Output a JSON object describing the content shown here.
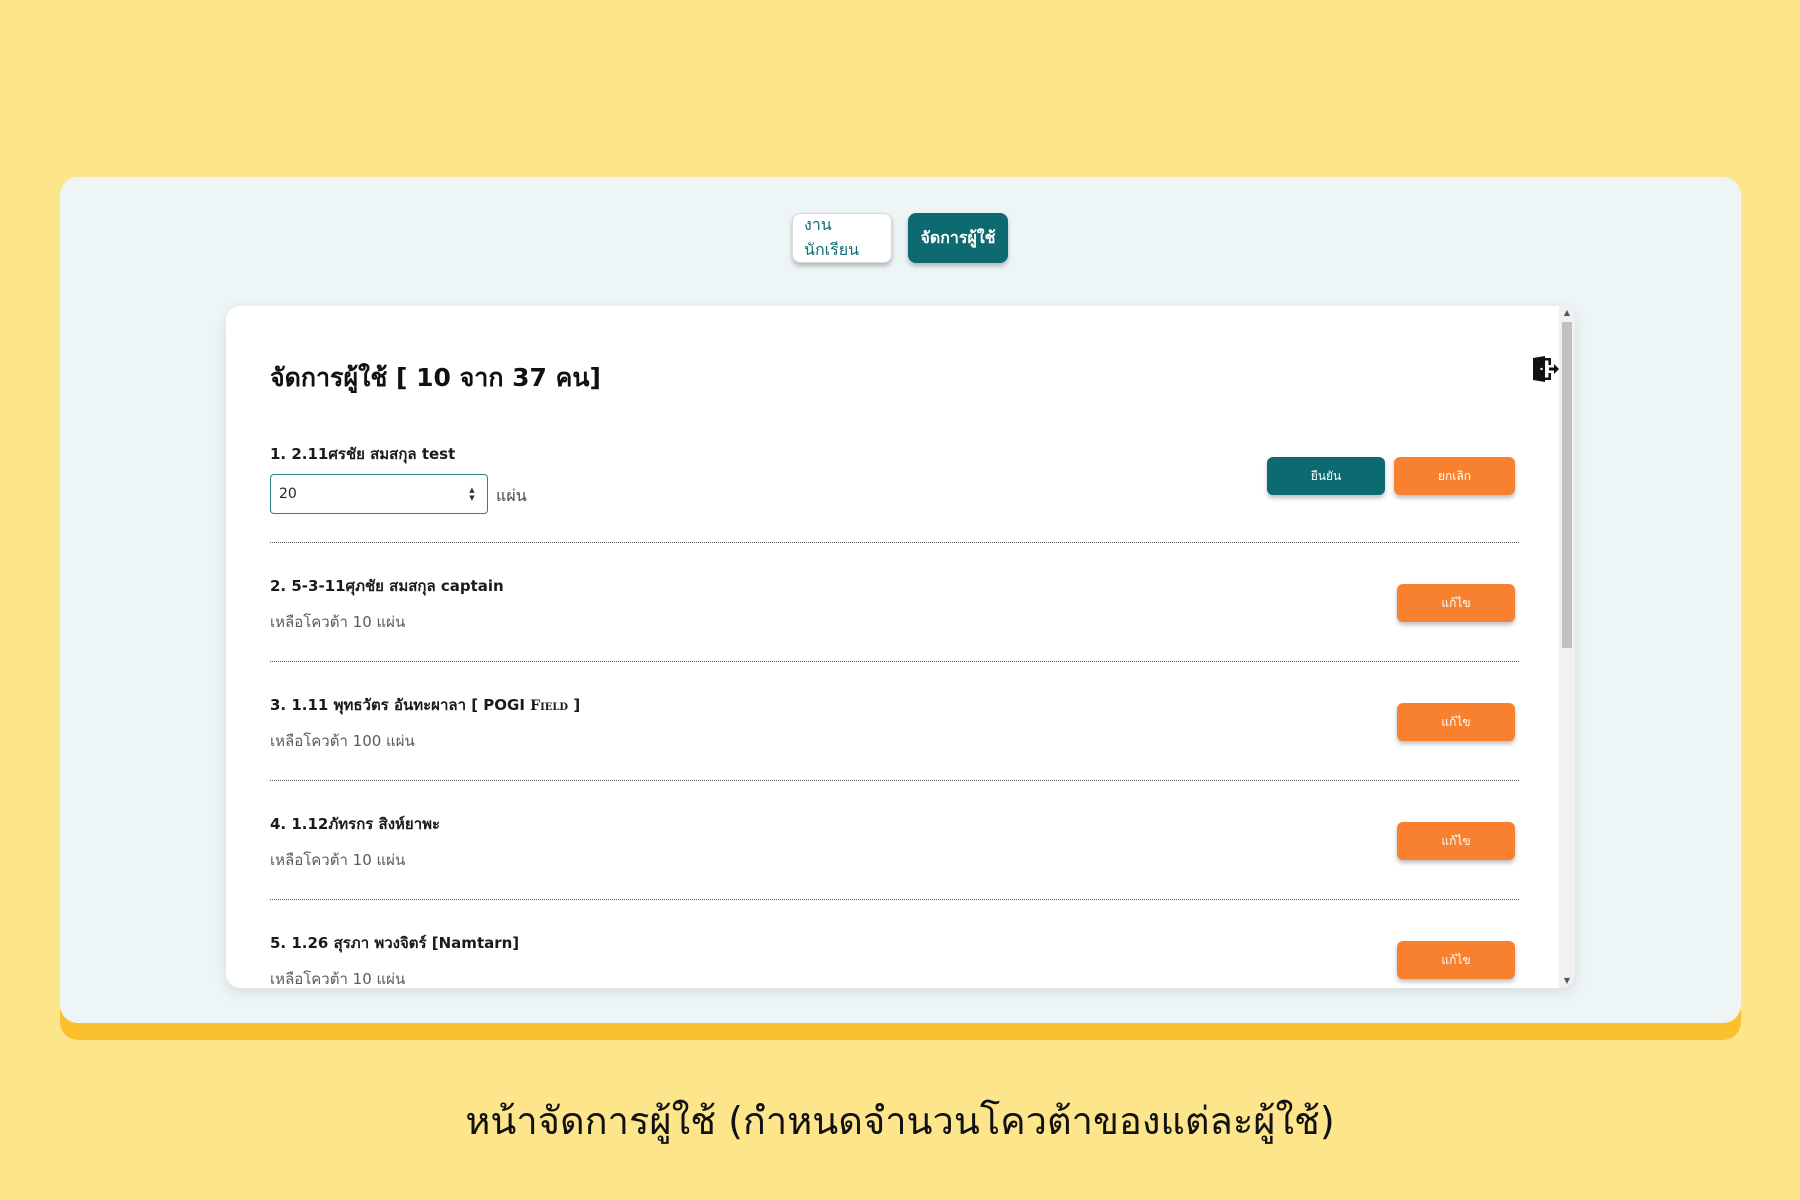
{
  "tabs": {
    "student_work": "งานนักเรียน",
    "manage_users": "จัดการผู้ใช้"
  },
  "panel": {
    "title": "จัดการผู้ใช้ [ 10 จาก 37 คน]",
    "logout_icon": "logout-icon"
  },
  "editing_row": {
    "name": "1. 2.11ศรชัย สมสกุล test",
    "quantity_value": "20",
    "unit": "แผ่น",
    "confirm_label": "ยืนยัน",
    "cancel_label": "ยกเลิก"
  },
  "rows": [
    {
      "name": "2. 5-3-11ศุภชัย สมสกุล captain",
      "quota": "เหลือโควต้า 10 แผ่น",
      "edit_label": "แก้ไข"
    },
    {
      "name_prefix": "3. 1.11 พุทธวัตร อันทะผาลา [ POGI ",
      "name_smallcaps": "Field",
      "name_suffix": " ]",
      "quota": "เหลือโควต้า 100 แผ่น",
      "edit_label": "แก้ไข"
    },
    {
      "name": "4. 1.12ภัทรกร สิงห์ยาพะ",
      "quota": "เหลือโควต้า 10 แผ่น",
      "edit_label": "แก้ไข"
    },
    {
      "name": "5. 1.26 สุรภา พวงจิตร์ [Namtarn]",
      "quota": "เหลือโควต้า 10 แผ่น",
      "edit_label": "แก้ไข"
    }
  ],
  "caption": "หน้าจัดการผู้ใช้ (กำหนดจำนวนโควต้าของแต่ละผู้ใช้)",
  "colors": {
    "background": "#fde58c",
    "frame": "#edf5f7",
    "frame_shadow": "#fbc02d",
    "teal": "#0c6a70",
    "orange": "#f7812e"
  }
}
